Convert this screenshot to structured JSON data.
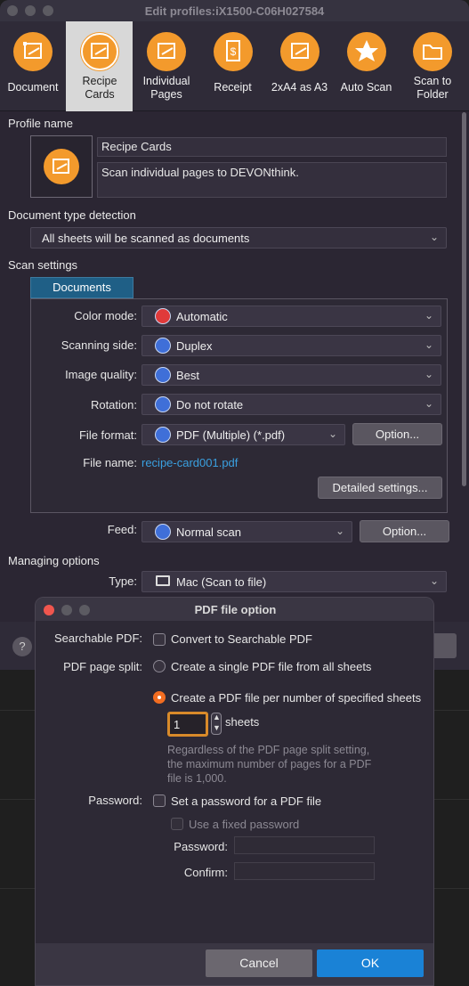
{
  "window": {
    "title": "Edit profiles:iX1500-C06H027584"
  },
  "toolbar": {
    "items": [
      {
        "label": "Document",
        "icon": "document-scan-icon"
      },
      {
        "label": "Recipe Cards",
        "icon": "recipe-cards-icon",
        "selected": true
      },
      {
        "label": "Individual Pages",
        "icon": "individual-pages-icon"
      },
      {
        "label": "Receipt",
        "icon": "receipt-icon"
      },
      {
        "label": "2xA4 as A3",
        "icon": "a4-as-a3-icon"
      },
      {
        "label": "Auto Scan",
        "icon": "star-icon"
      },
      {
        "label": "Scan to Folder",
        "icon": "folder-icon"
      }
    ]
  },
  "profile": {
    "section_label": "Profile name",
    "name": "Recipe Cards",
    "description": "Scan individual pages to DEVONthink."
  },
  "detection": {
    "section_label": "Document type detection",
    "value": "All sheets will be scanned as documents"
  },
  "scan_settings": {
    "section_label": "Scan settings",
    "tab": "Documents",
    "color_mode": {
      "label": "Color mode:",
      "value": "Automatic"
    },
    "scanning_side": {
      "label": "Scanning side:",
      "value": "Duplex"
    },
    "image_quality": {
      "label": "Image quality:",
      "value": "Best"
    },
    "rotation": {
      "label": "Rotation:",
      "value": "Do not rotate"
    },
    "file_format": {
      "label": "File format:",
      "value": "PDF (Multiple) (*.pdf)",
      "option_button": "Option..."
    },
    "file_name": {
      "label": "File name:",
      "value": "recipe-card001.pdf"
    },
    "detailed_button": "Detailed settings...",
    "feed": {
      "label": "Feed:",
      "value": "Normal scan",
      "option_button": "Option..."
    }
  },
  "managing": {
    "section_label": "Managing options",
    "type": {
      "label": "Type:",
      "value": "Mac (Scan to file)"
    }
  },
  "help": "?",
  "dialog": {
    "title": "PDF file option",
    "searchable": {
      "label": "Searchable PDF:",
      "option": "Convert to Searchable PDF"
    },
    "split": {
      "label": "PDF page split:",
      "option1": "Create a single PDF file from all sheets",
      "option2": "Create a PDF file per number of specified sheets",
      "sheets_value": "1",
      "sheets_unit": "sheets",
      "note_line1": "Regardless of the PDF page split setting,",
      "note_line2": "the maximum number of pages for a PDF",
      "note_line3": "file is 1,000."
    },
    "password": {
      "label": "Password:",
      "option": "Set a password for a PDF file",
      "fixed": "Use a fixed password",
      "password_label": "Password:",
      "confirm_label": "Confirm:"
    },
    "cancel": "Cancel",
    "ok": "OK"
  },
  "colors": {
    "accent": "#f39a2c",
    "ok_blue": "#1a82d6",
    "link": "#3aa0e0"
  }
}
